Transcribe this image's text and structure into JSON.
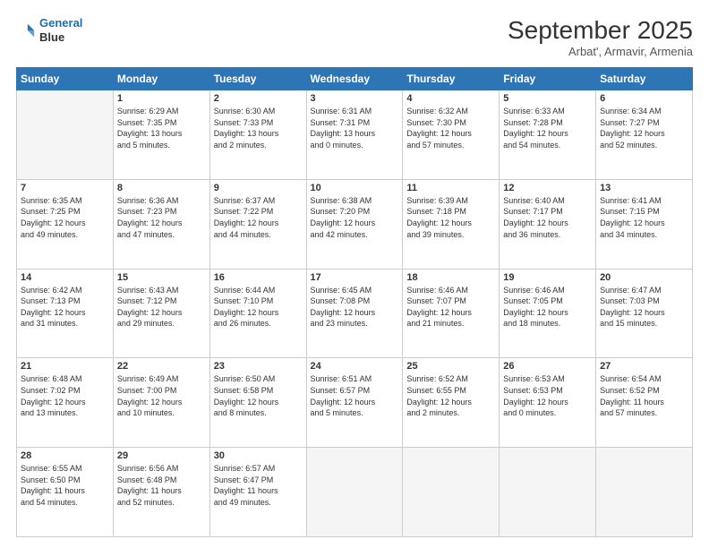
{
  "header": {
    "logo_line1": "General",
    "logo_line2": "Blue",
    "title": "September 2025",
    "subtitle": "Arbat', Armavir, Armenia"
  },
  "days_of_week": [
    "Sunday",
    "Monday",
    "Tuesday",
    "Wednesday",
    "Thursday",
    "Friday",
    "Saturday"
  ],
  "weeks": [
    [
      {
        "day": "",
        "info": ""
      },
      {
        "day": "1",
        "info": "Sunrise: 6:29 AM\nSunset: 7:35 PM\nDaylight: 13 hours\nand 5 minutes."
      },
      {
        "day": "2",
        "info": "Sunrise: 6:30 AM\nSunset: 7:33 PM\nDaylight: 13 hours\nand 2 minutes."
      },
      {
        "day": "3",
        "info": "Sunrise: 6:31 AM\nSunset: 7:31 PM\nDaylight: 13 hours\nand 0 minutes."
      },
      {
        "day": "4",
        "info": "Sunrise: 6:32 AM\nSunset: 7:30 PM\nDaylight: 12 hours\nand 57 minutes."
      },
      {
        "day": "5",
        "info": "Sunrise: 6:33 AM\nSunset: 7:28 PM\nDaylight: 12 hours\nand 54 minutes."
      },
      {
        "day": "6",
        "info": "Sunrise: 6:34 AM\nSunset: 7:27 PM\nDaylight: 12 hours\nand 52 minutes."
      }
    ],
    [
      {
        "day": "7",
        "info": "Sunrise: 6:35 AM\nSunset: 7:25 PM\nDaylight: 12 hours\nand 49 minutes."
      },
      {
        "day": "8",
        "info": "Sunrise: 6:36 AM\nSunset: 7:23 PM\nDaylight: 12 hours\nand 47 minutes."
      },
      {
        "day": "9",
        "info": "Sunrise: 6:37 AM\nSunset: 7:22 PM\nDaylight: 12 hours\nand 44 minutes."
      },
      {
        "day": "10",
        "info": "Sunrise: 6:38 AM\nSunset: 7:20 PM\nDaylight: 12 hours\nand 42 minutes."
      },
      {
        "day": "11",
        "info": "Sunrise: 6:39 AM\nSunset: 7:18 PM\nDaylight: 12 hours\nand 39 minutes."
      },
      {
        "day": "12",
        "info": "Sunrise: 6:40 AM\nSunset: 7:17 PM\nDaylight: 12 hours\nand 36 minutes."
      },
      {
        "day": "13",
        "info": "Sunrise: 6:41 AM\nSunset: 7:15 PM\nDaylight: 12 hours\nand 34 minutes."
      }
    ],
    [
      {
        "day": "14",
        "info": "Sunrise: 6:42 AM\nSunset: 7:13 PM\nDaylight: 12 hours\nand 31 minutes."
      },
      {
        "day": "15",
        "info": "Sunrise: 6:43 AM\nSunset: 7:12 PM\nDaylight: 12 hours\nand 29 minutes."
      },
      {
        "day": "16",
        "info": "Sunrise: 6:44 AM\nSunset: 7:10 PM\nDaylight: 12 hours\nand 26 minutes."
      },
      {
        "day": "17",
        "info": "Sunrise: 6:45 AM\nSunset: 7:08 PM\nDaylight: 12 hours\nand 23 minutes."
      },
      {
        "day": "18",
        "info": "Sunrise: 6:46 AM\nSunset: 7:07 PM\nDaylight: 12 hours\nand 21 minutes."
      },
      {
        "day": "19",
        "info": "Sunrise: 6:46 AM\nSunset: 7:05 PM\nDaylight: 12 hours\nand 18 minutes."
      },
      {
        "day": "20",
        "info": "Sunrise: 6:47 AM\nSunset: 7:03 PM\nDaylight: 12 hours\nand 15 minutes."
      }
    ],
    [
      {
        "day": "21",
        "info": "Sunrise: 6:48 AM\nSunset: 7:02 PM\nDaylight: 12 hours\nand 13 minutes."
      },
      {
        "day": "22",
        "info": "Sunrise: 6:49 AM\nSunset: 7:00 PM\nDaylight: 12 hours\nand 10 minutes."
      },
      {
        "day": "23",
        "info": "Sunrise: 6:50 AM\nSunset: 6:58 PM\nDaylight: 12 hours\nand 8 minutes."
      },
      {
        "day": "24",
        "info": "Sunrise: 6:51 AM\nSunset: 6:57 PM\nDaylight: 12 hours\nand 5 minutes."
      },
      {
        "day": "25",
        "info": "Sunrise: 6:52 AM\nSunset: 6:55 PM\nDaylight: 12 hours\nand 2 minutes."
      },
      {
        "day": "26",
        "info": "Sunrise: 6:53 AM\nSunset: 6:53 PM\nDaylight: 12 hours\nand 0 minutes."
      },
      {
        "day": "27",
        "info": "Sunrise: 6:54 AM\nSunset: 6:52 PM\nDaylight: 11 hours\nand 57 minutes."
      }
    ],
    [
      {
        "day": "28",
        "info": "Sunrise: 6:55 AM\nSunset: 6:50 PM\nDaylight: 11 hours\nand 54 minutes."
      },
      {
        "day": "29",
        "info": "Sunrise: 6:56 AM\nSunset: 6:48 PM\nDaylight: 11 hours\nand 52 minutes."
      },
      {
        "day": "30",
        "info": "Sunrise: 6:57 AM\nSunset: 6:47 PM\nDaylight: 11 hours\nand 49 minutes."
      },
      {
        "day": "",
        "info": ""
      },
      {
        "day": "",
        "info": ""
      },
      {
        "day": "",
        "info": ""
      },
      {
        "day": "",
        "info": ""
      }
    ]
  ]
}
